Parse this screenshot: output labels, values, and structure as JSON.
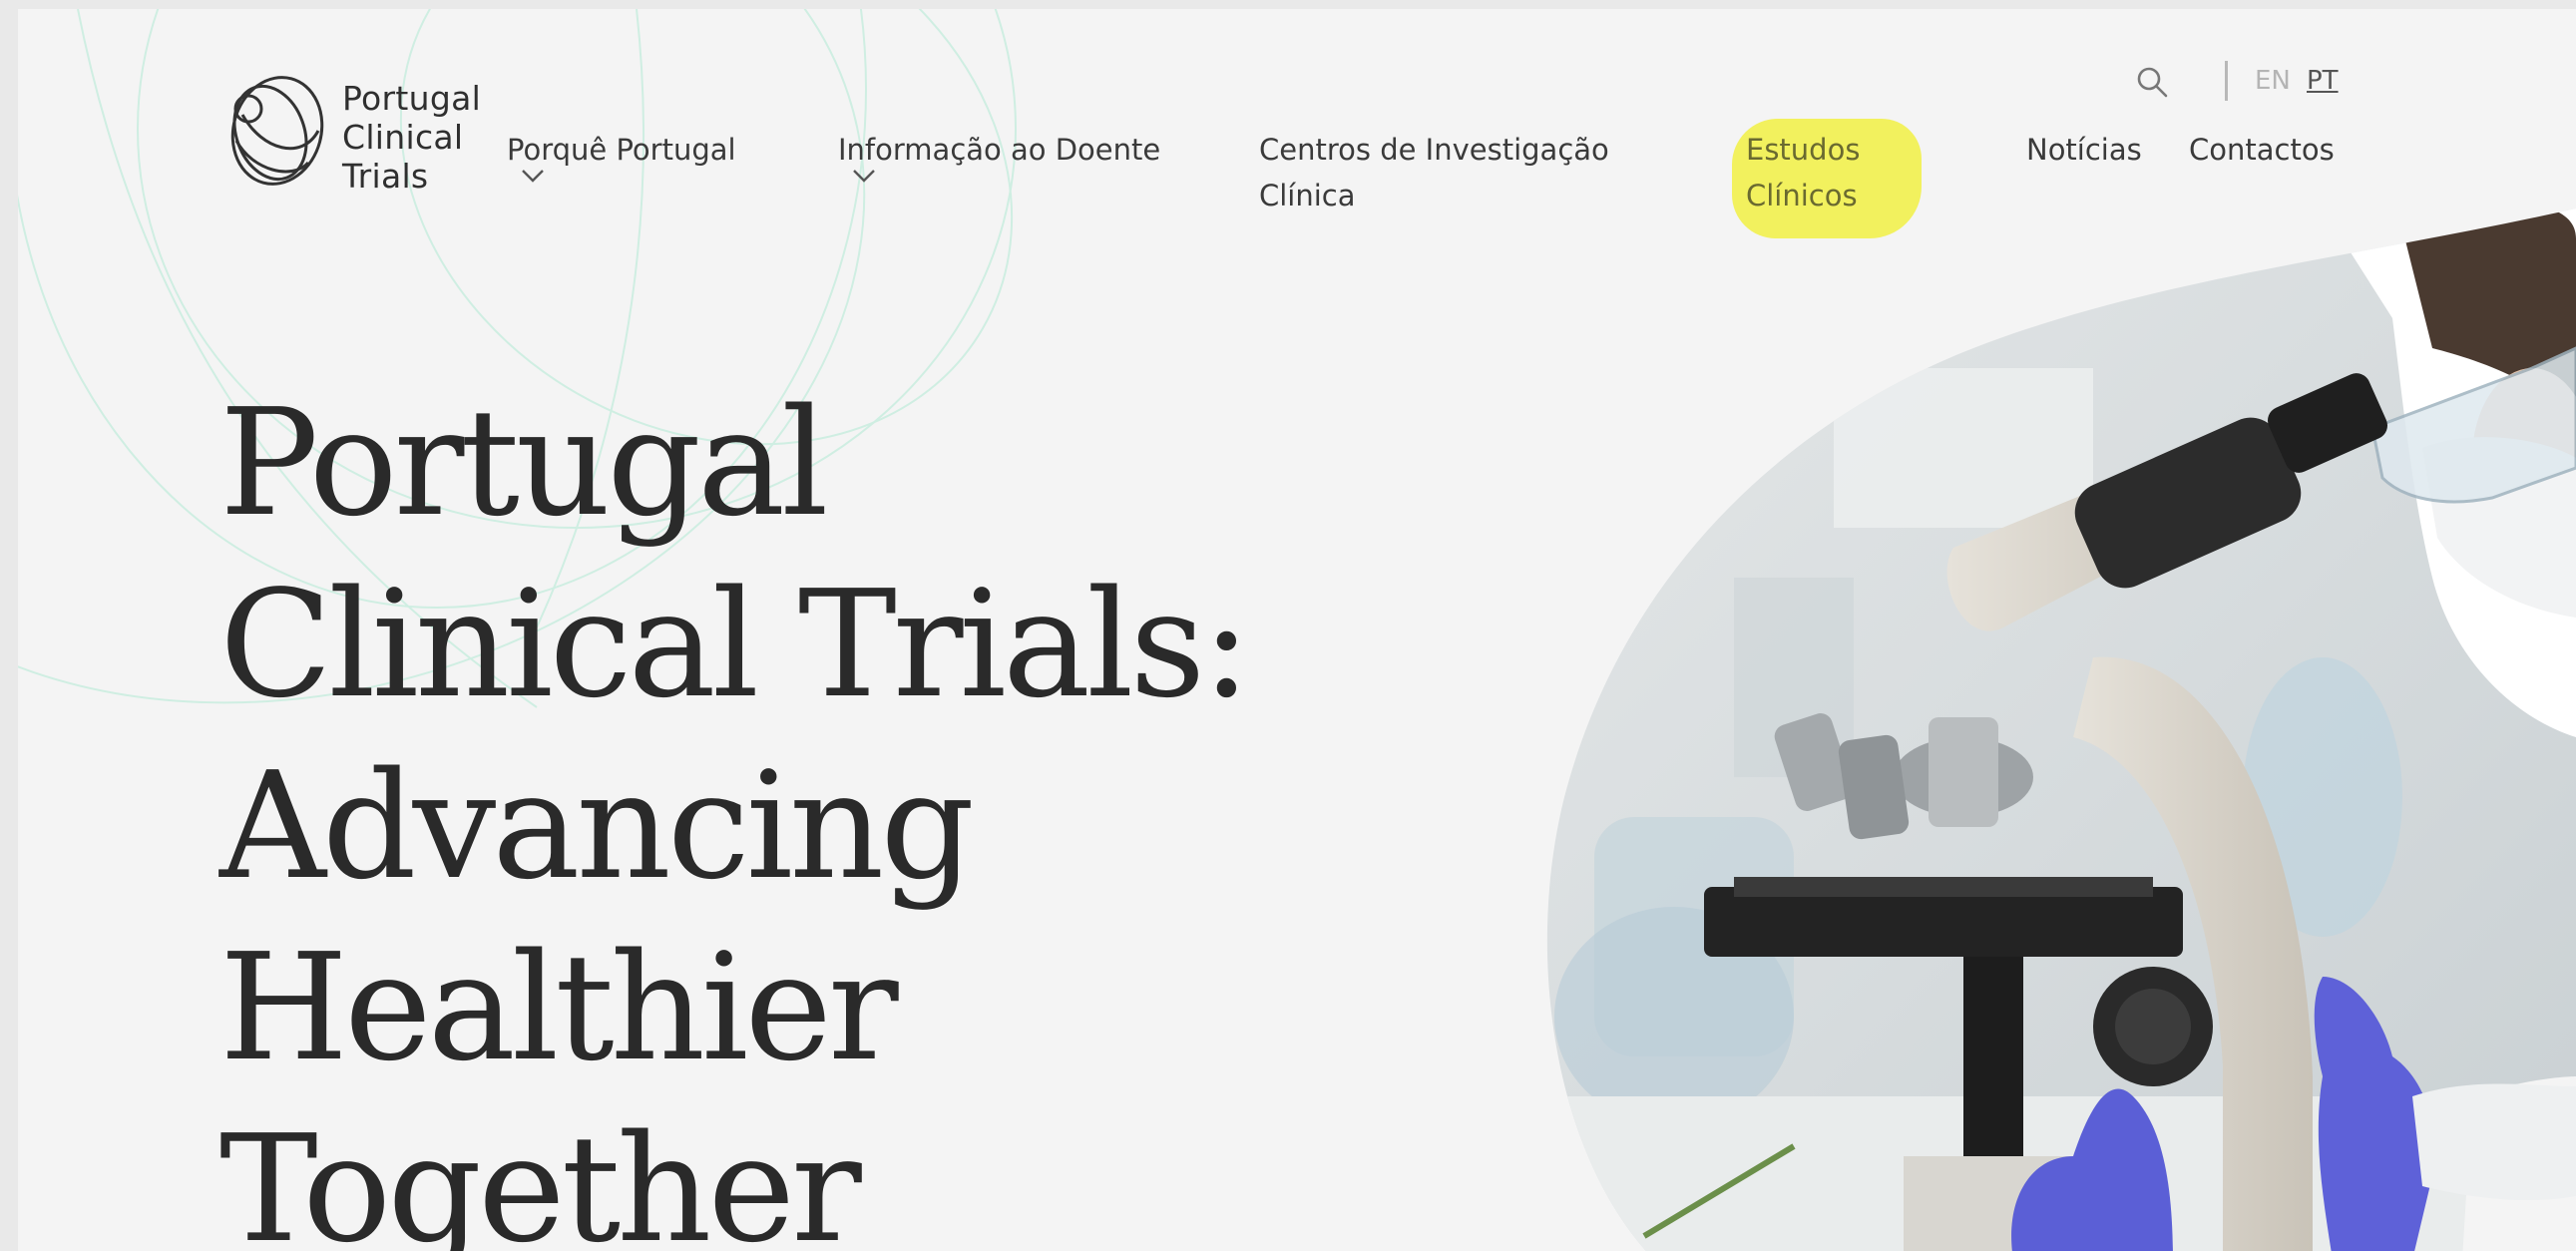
{
  "header": {
    "logo": {
      "line1": "Portugal",
      "line2": "Clinical",
      "line3": "Trials"
    },
    "nav": [
      {
        "label": "Porquê Portugal",
        "has_dropdown": true
      },
      {
        "label": "Informação ao Doente",
        "has_dropdown": true
      },
      {
        "label_line1": "Centros de Investigação",
        "label_line2": "Clínica",
        "has_dropdown": false
      },
      {
        "label_line1": "Estudos",
        "label_line2": "Clínicos",
        "has_dropdown": false,
        "highlighted": true
      },
      {
        "label": "Notícias",
        "has_dropdown": false
      },
      {
        "label": "Contactos",
        "has_dropdown": false
      }
    ],
    "search_icon": "search-icon",
    "languages": [
      {
        "code": "EN",
        "active": false
      },
      {
        "code": "PT",
        "active": true
      }
    ]
  },
  "hero": {
    "title_lines": [
      "Portugal",
      "Clinical Trials:",
      "Advancing",
      "Healthier",
      "Together"
    ],
    "image": "scientist-microscope-photo"
  },
  "colors": {
    "background": "#f4f4f4",
    "text": "#2a2a2a",
    "highlight": "#f1f050",
    "decorative_lines": "#cfeee2",
    "glove": "#5b5fd6"
  }
}
